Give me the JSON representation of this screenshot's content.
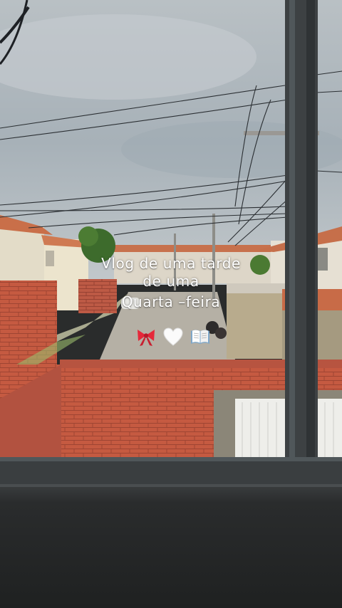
{
  "overlay": {
    "caption_lines": [
      "Vlog de uma tarde",
      "de uma",
      "Quarta –feira"
    ],
    "emojis": [
      "ribbon-icon",
      "white-heart-icon",
      "open-book-icon"
    ]
  },
  "colors": {
    "sky": "#a9b2b8",
    "brick": "#c8553e",
    "roof": "#c9714b",
    "window_frame": "#3d4143",
    "sill": "#222424"
  }
}
